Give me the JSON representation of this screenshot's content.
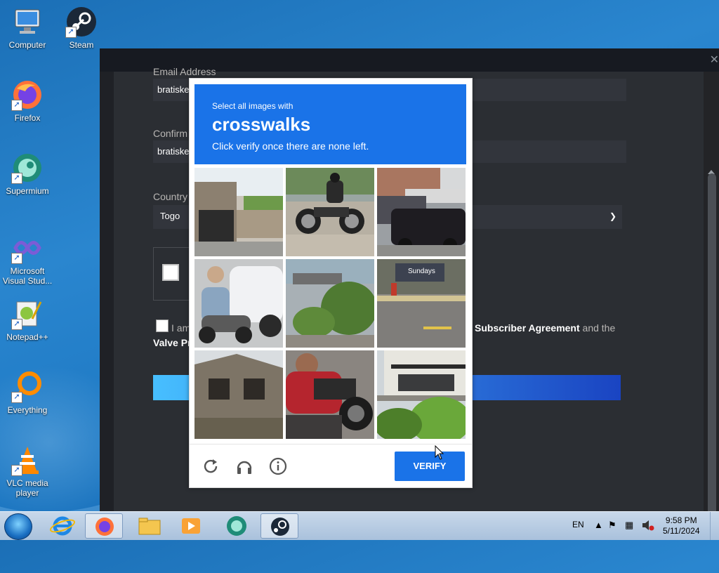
{
  "desktop": {
    "icons": [
      {
        "label": "Computer",
        "icon": "computer-icon"
      },
      {
        "label": "Steam",
        "icon": "steam-icon"
      },
      {
        "label": "Firefox",
        "icon": "firefox-icon"
      },
      {
        "label": "Supermium",
        "icon": "supermium-icon"
      },
      {
        "label": "Microsoft Visual Stud...",
        "icon": "visual-studio-icon"
      },
      {
        "label": "Notepad++",
        "icon": "notepadpp-icon"
      },
      {
        "label": "Everything",
        "icon": "everything-icon"
      },
      {
        "label": "VLC media player",
        "icon": "vlc-icon"
      }
    ]
  },
  "steam_form": {
    "email_label": "Email Address",
    "email_value": "bratiske",
    "confirm_label": "Confirm",
    "confirm_value": "bratiske",
    "country_label": "Country",
    "country_value": "Togo",
    "agree_prefix": "I am",
    "agree_link1": "Subscriber Agreement",
    "agree_mid": "and the",
    "agree_link2": "Valve Pr",
    "close_glyph": "✕"
  },
  "captcha": {
    "prompt_small": "Select all images with",
    "prompt_big": "crosswalks",
    "prompt_sub": "Click verify once there are none left.",
    "verify_label": "VERIFY",
    "tiles": [
      {
        "desc": "house-garage"
      },
      {
        "desc": "motorcycle-rider"
      },
      {
        "desc": "black-suv-street"
      },
      {
        "desc": "scooter-rider"
      },
      {
        "desc": "shrubs-fence"
      },
      {
        "desc": "sundays-sign-road"
      },
      {
        "desc": "apartment-building"
      },
      {
        "desc": "motorcycle-closeup"
      },
      {
        "desc": "house-balcony-tree"
      }
    ],
    "footer_icons": [
      "reload-icon",
      "audio-icon",
      "info-icon"
    ]
  },
  "taskbar": {
    "language": "EN",
    "time": "9:58 PM",
    "date": "5/11/2024",
    "apps": [
      "internet-explorer-icon",
      "firefox-icon",
      "file-explorer-icon",
      "media-player-icon",
      "supermium-icon",
      "steam-icon"
    ]
  }
}
